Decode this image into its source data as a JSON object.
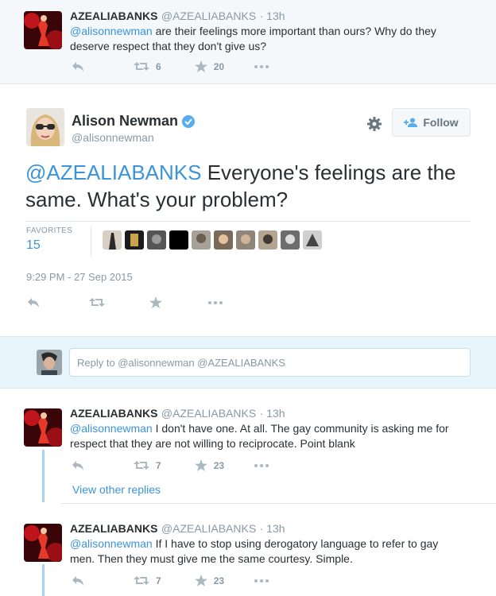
{
  "top_tweet": {
    "name": "AZEALIABANKS",
    "handle": "@AZEALIABANKS",
    "time": "· 13h",
    "mention": "@alisonnewman",
    "text_line1": " are their feelings more important than ours? Why do they",
    "text_line2": "deserve respect that they don't give us?",
    "retweets": "6",
    "favorites": "20"
  },
  "main_tweet": {
    "name": "Alison Newman",
    "handle": "@alisonnewman",
    "follow_label": "Follow",
    "mention": "@AZEALIABANKS",
    "text": " Everyone's feelings are the same. What's your problem?",
    "favorites_label": "FAVORITES",
    "favorites_count": "15",
    "timestamp": "9:29 PM - 27 Sep 2015"
  },
  "reply_box": {
    "placeholder": "Reply to @alisonnewman @AZEALIABANKS"
  },
  "replies": [
    {
      "name": "AZEALIABANKS",
      "handle": "@AZEALIABANKS",
      "time": "· 13h",
      "mention": "@alisonnewman",
      "text_line1": " I don't have one. At all. The gay community is asking me for",
      "text_line2": "respect that they are not willing to reciprocate. Point blank",
      "retweets": "7",
      "favorites": "23"
    },
    {
      "name": "AZEALIABANKS",
      "handle": "@AZEALIABANKS",
      "time": "· 13h",
      "mention": "@alisonnewman",
      "text_line1": " If I have to stop using derogatory language to refer to gay",
      "text_line2": "men. Then they must give me the same courtesy. Simple.",
      "retweets": "7",
      "favorites": "23"
    }
  ],
  "view_other_replies": "View other replies",
  "colors": {
    "accent": "#3b94d9",
    "verified": "#55acee",
    "muted": "#8899a6"
  }
}
